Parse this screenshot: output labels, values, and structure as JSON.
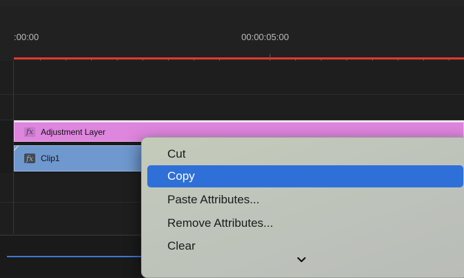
{
  "ruler": {
    "timecode_start": ":00:00",
    "timecode_mid": "00:00:05:00"
  },
  "tracks": {
    "adjustment_layer": {
      "label": "Adjustment Layer",
      "fx": "fx"
    },
    "clip1": {
      "label": "Clip1",
      "fx": "fx"
    }
  },
  "context_menu": {
    "items": [
      {
        "label": "Cut",
        "selected": false
      },
      {
        "label": "Copy",
        "selected": true
      },
      {
        "label": "Paste Attributes...",
        "selected": false
      },
      {
        "label": "Remove Attributes...",
        "selected": false
      },
      {
        "label": "Clear",
        "selected": false
      }
    ],
    "more_icon": "chevron-down-icon"
  },
  "colors": {
    "playhead": "#e23a2d",
    "adjustment_layer": "#de85de",
    "clip": "#6f98cf",
    "menu_highlight": "#2f6fd8"
  }
}
